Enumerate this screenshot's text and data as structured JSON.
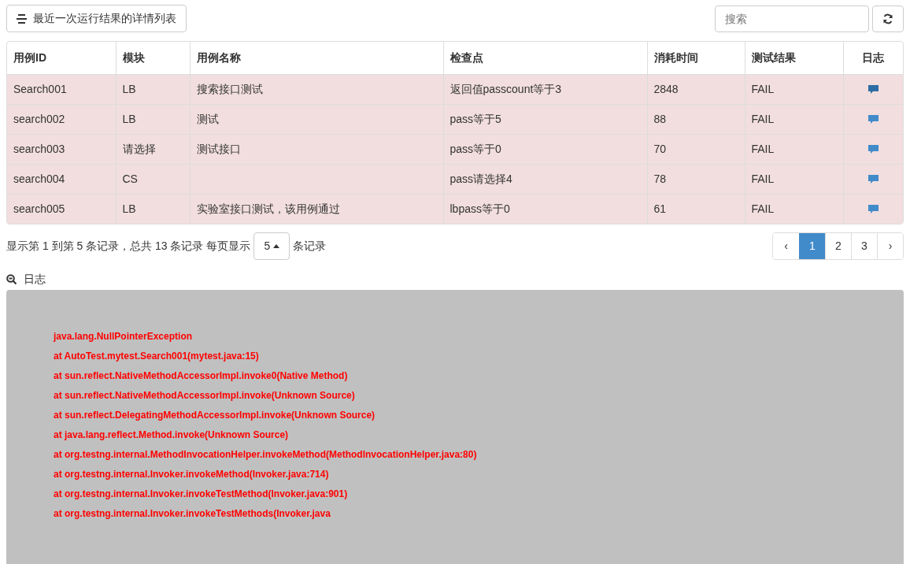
{
  "header_button": {
    "label": "最近一次运行结果的详情列表"
  },
  "search": {
    "placeholder": "搜索"
  },
  "table": {
    "columns": [
      "用例ID",
      "模块",
      "用例名称",
      "检查点",
      "消耗时间",
      "测试结果",
      "日志"
    ],
    "rows": [
      {
        "cells": [
          "Search001",
          "LB",
          "搜索接口测试",
          "返回值passcount等于3",
          "2848",
          "FAIL"
        ],
        "selected": true
      },
      {
        "cells": [
          "search002",
          "LB",
          "测试",
          "pass等于5",
          "88",
          "FAIL"
        ],
        "selected": false
      },
      {
        "cells": [
          "search003",
          "请选择",
          "测试接口",
          "pass等于0",
          "70",
          "FAIL"
        ],
        "selected": false
      },
      {
        "cells": [
          "search004",
          "CS",
          "",
          "pass请选择4",
          "78",
          "FAIL"
        ],
        "selected": false
      },
      {
        "cells": [
          "search005",
          "LB",
          "实验室接口测试，该用例通过",
          "lbpass等于0",
          "61",
          "FAIL"
        ],
        "selected": false
      }
    ]
  },
  "pagination_info": {
    "summary": "显示第 1 到第 5 条记录，总共 13 条记录 每页显示",
    "page_size": "5",
    "suffix": "条记录"
  },
  "pagination": {
    "prev": "‹",
    "next": "›",
    "pages": [
      {
        "label": "1",
        "selected": true
      },
      {
        "label": "2",
        "selected": false
      },
      {
        "label": "3",
        "selected": false
      }
    ]
  },
  "log": {
    "title": "日志",
    "lines": [
      "java.lang.NullPointerException",
      "at AutoTest.mytest.Search001(mytest.java:15)",
      "at sun.reflect.NativeMethodAccessorImpl.invoke0(Native Method)",
      "at sun.reflect.NativeMethodAccessorImpl.invoke(Unknown Source)",
      "at sun.reflect.DelegatingMethodAccessorImpl.invoke(Unknown Source)",
      "at java.lang.reflect.Method.invoke(Unknown Source)",
      "at org.testng.internal.MethodInvocationHelper.invokeMethod(MethodInvocationHelper.java:80)",
      "at org.testng.internal.Invoker.invokeMethod(Invoker.java:714)",
      "at org.testng.internal.Invoker.invokeTestMethod(Invoker.java:901)",
      "at org.testng.internal.Invoker.invokeTestMethods(Invoker.java"
    ]
  }
}
